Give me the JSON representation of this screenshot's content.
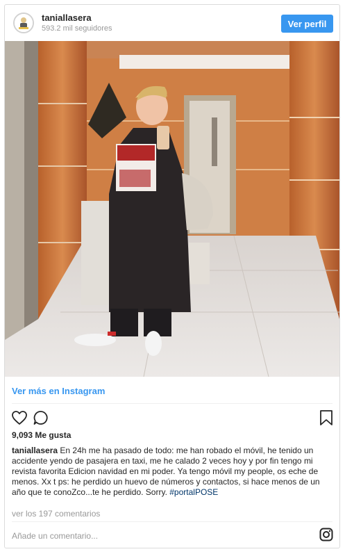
{
  "header": {
    "username": "taniallasera",
    "followers": "593.2 mil seguidores",
    "follow_button": "Ver perfil"
  },
  "post": {
    "view_more": "Ver más en Instagram",
    "likes": "9,093 Me gusta",
    "caption_user": "taniallasera",
    "caption_text": "En 24h me ha pasado de todo: me han robado el móvil, he tenido un accidente yendo de pasajera en taxi, me he calado 2 veces hoy y por fin tengo mi revista favorita Edicion navidad en mi poder. Ya tengo móvil my people, os eche de menos. Xx t ps: he perdido un huevo de números y contactos, si hace menos de un año que te conoZco...te he perdido. Sorry. ",
    "caption_hashtag": "#portalPOSE",
    "comments_link": "ver los 197 comentarios",
    "comment_placeholder": "Añade un comentario..."
  },
  "icons": {
    "like": "heart-icon",
    "comment": "comment-icon",
    "save": "bookmark-icon",
    "brand": "instagram-icon"
  },
  "colors": {
    "accent": "#3897f0",
    "hashtag": "#003569",
    "muted": "#999999"
  }
}
